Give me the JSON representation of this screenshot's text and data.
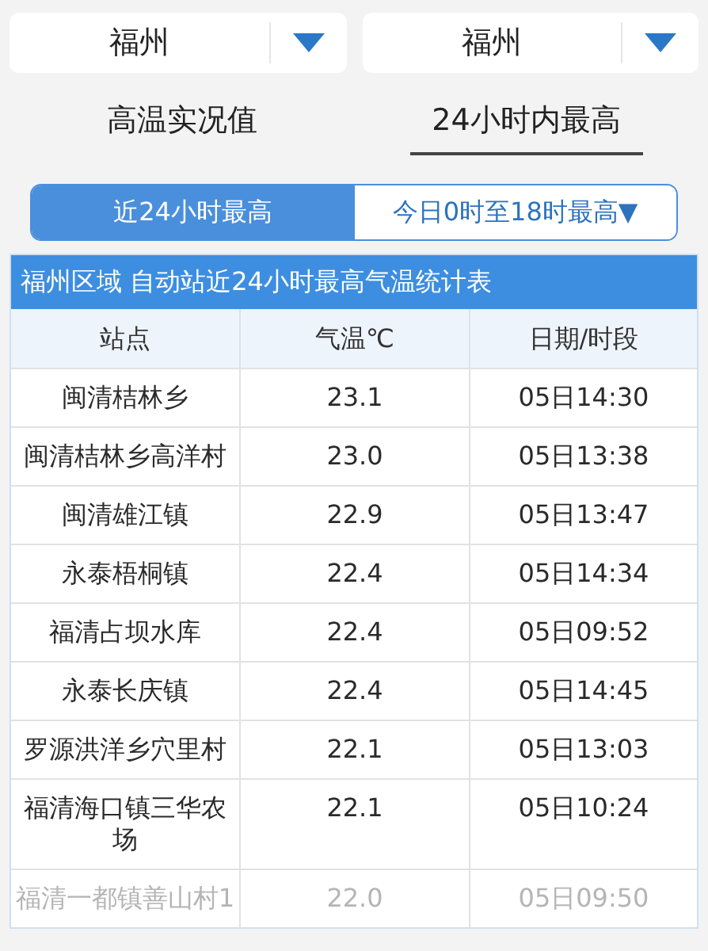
{
  "selectors": [
    {
      "value": "福州"
    },
    {
      "value": "福州"
    }
  ],
  "tabs": [
    {
      "label": "高温实况值",
      "selected": false
    },
    {
      "label": "24小时内最高",
      "selected": true
    }
  ],
  "segments": [
    {
      "label": "近24小时最高",
      "selected": true
    },
    {
      "label": "今日0时至18时最高▼",
      "selected": false
    }
  ],
  "table": {
    "title": "福州区域 自动站近24小时最高气温统计表",
    "columns": [
      "站点",
      "气温℃",
      "日期/时段"
    ],
    "rows": [
      {
        "cells": [
          "闽清桔林乡",
          "23.1",
          "05日14:30"
        ],
        "dimmed": false
      },
      {
        "cells": [
          "闽清桔林乡高洋村",
          "23.0",
          "05日13:38"
        ],
        "dimmed": false
      },
      {
        "cells": [
          "闽清雄江镇",
          "22.9",
          "05日13:47"
        ],
        "dimmed": false
      },
      {
        "cells": [
          "永泰梧桐镇",
          "22.4",
          "05日14:34"
        ],
        "dimmed": false
      },
      {
        "cells": [
          "福清占坝水库",
          "22.4",
          "05日09:52"
        ],
        "dimmed": false
      },
      {
        "cells": [
          "永泰长庆镇",
          "22.4",
          "05日14:45"
        ],
        "dimmed": false
      },
      {
        "cells": [
          "罗源洪洋乡穴里村",
          "22.1",
          "05日13:03"
        ],
        "dimmed": false
      },
      {
        "cells": [
          "福清海口镇三华农场",
          "22.1",
          "05日10:24"
        ],
        "dimmed": false
      },
      {
        "cells": [
          "福清一都镇善山村1",
          "22.0",
          "05日09:50"
        ],
        "dimmed": true
      }
    ]
  }
}
